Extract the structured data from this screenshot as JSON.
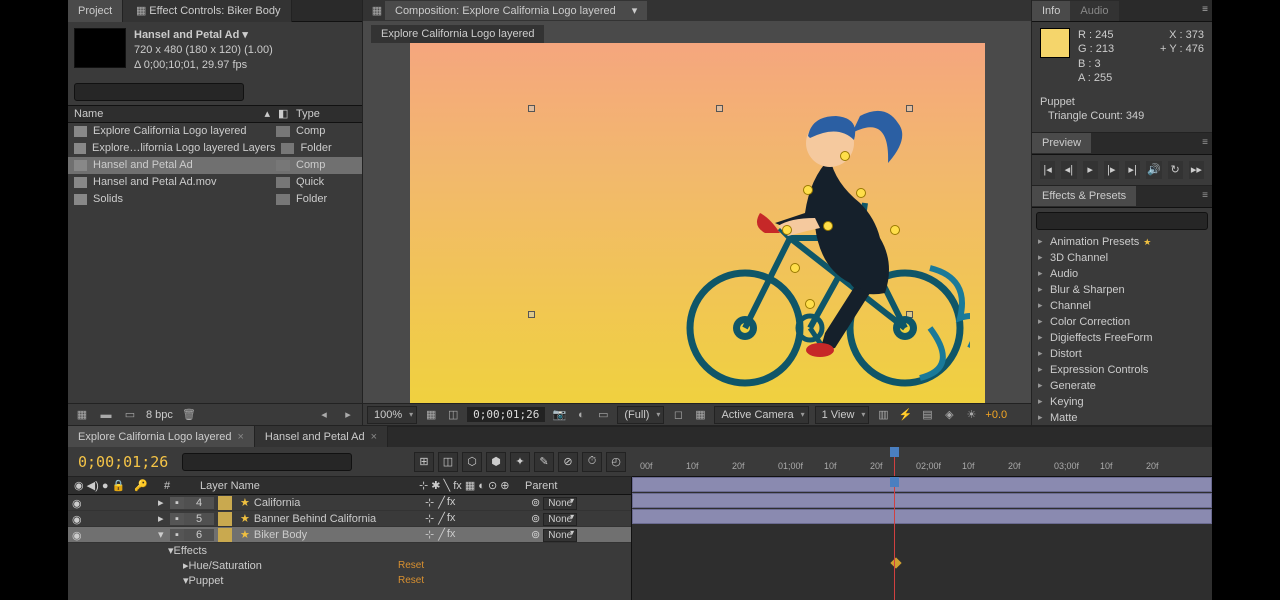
{
  "project": {
    "tab_project": "Project",
    "tab_effect_controls": "Effect Controls: Biker Body",
    "item_title": "Hansel and Petal Ad ▾",
    "dims": "720 x 480   (180 x 120) (1.00)",
    "duration": "Δ 0;00;10;01, 29.97 fps",
    "col_name": "Name",
    "col_type": "Type",
    "items": [
      {
        "name": "Explore California Logo layered",
        "type": "Comp"
      },
      {
        "name": "Explore…lifornia Logo layered Layers",
        "type": "Folder"
      },
      {
        "name": "Hansel and Petal Ad",
        "type": "Comp",
        "selected": true
      },
      {
        "name": "Hansel and Petal Ad.mov",
        "type": "Quick"
      },
      {
        "name": "Solids",
        "type": "Folder"
      }
    ],
    "bpc": "8 bpc",
    "search_placeholder": ""
  },
  "comp": {
    "header": "Composition: Explore California Logo layered",
    "tab": "Explore California Logo layered",
    "zoom": "100%",
    "timecode": "0;00;01;26",
    "resolution": "(Full)",
    "camera": "Active Camera",
    "view": "1 View",
    "exposure": "+0.0"
  },
  "info": {
    "tab_info": "Info",
    "tab_audio": "Audio",
    "r": "R : 245",
    "g": "G : 213",
    "b": "B : 3",
    "a": "A : 255",
    "x": "X : 373",
    "y": "+ Y : 476",
    "puppet": "Puppet",
    "tri": "Triangle Count: 349"
  },
  "preview": {
    "title": "Preview"
  },
  "effects": {
    "title": "Effects & Presets",
    "search_placeholder": "",
    "cats": [
      "Animation Presets",
      "3D Channel",
      "Audio",
      "Blur & Sharpen",
      "Channel",
      "Color Correction",
      "Digieffects FreeForm",
      "Distort",
      "Expression Controls",
      "Generate",
      "Keying",
      "Matte"
    ]
  },
  "timeline": {
    "tab1": "Explore California Logo layered",
    "tab2": "Hansel and Petal Ad",
    "time": "0;00;01;26",
    "col_layer": "Layer Name",
    "col_parent": "Parent",
    "layers": [
      {
        "num": "4",
        "name": "California",
        "parent": "None"
      },
      {
        "num": "5",
        "name": "Banner Behind California",
        "parent": "None"
      },
      {
        "num": "6",
        "name": "Biker Body",
        "parent": "None",
        "selected": true
      }
    ],
    "fx_effects": "Effects",
    "fx_hue": "Hue/Saturation",
    "fx_puppet": "Puppet",
    "reset": "Reset",
    "ruler": [
      "00f",
      "10f",
      "20f",
      "01;00f",
      "10f",
      "20f",
      "02;00f",
      "10f",
      "20f",
      "03;00f",
      "10f",
      "20f"
    ]
  }
}
